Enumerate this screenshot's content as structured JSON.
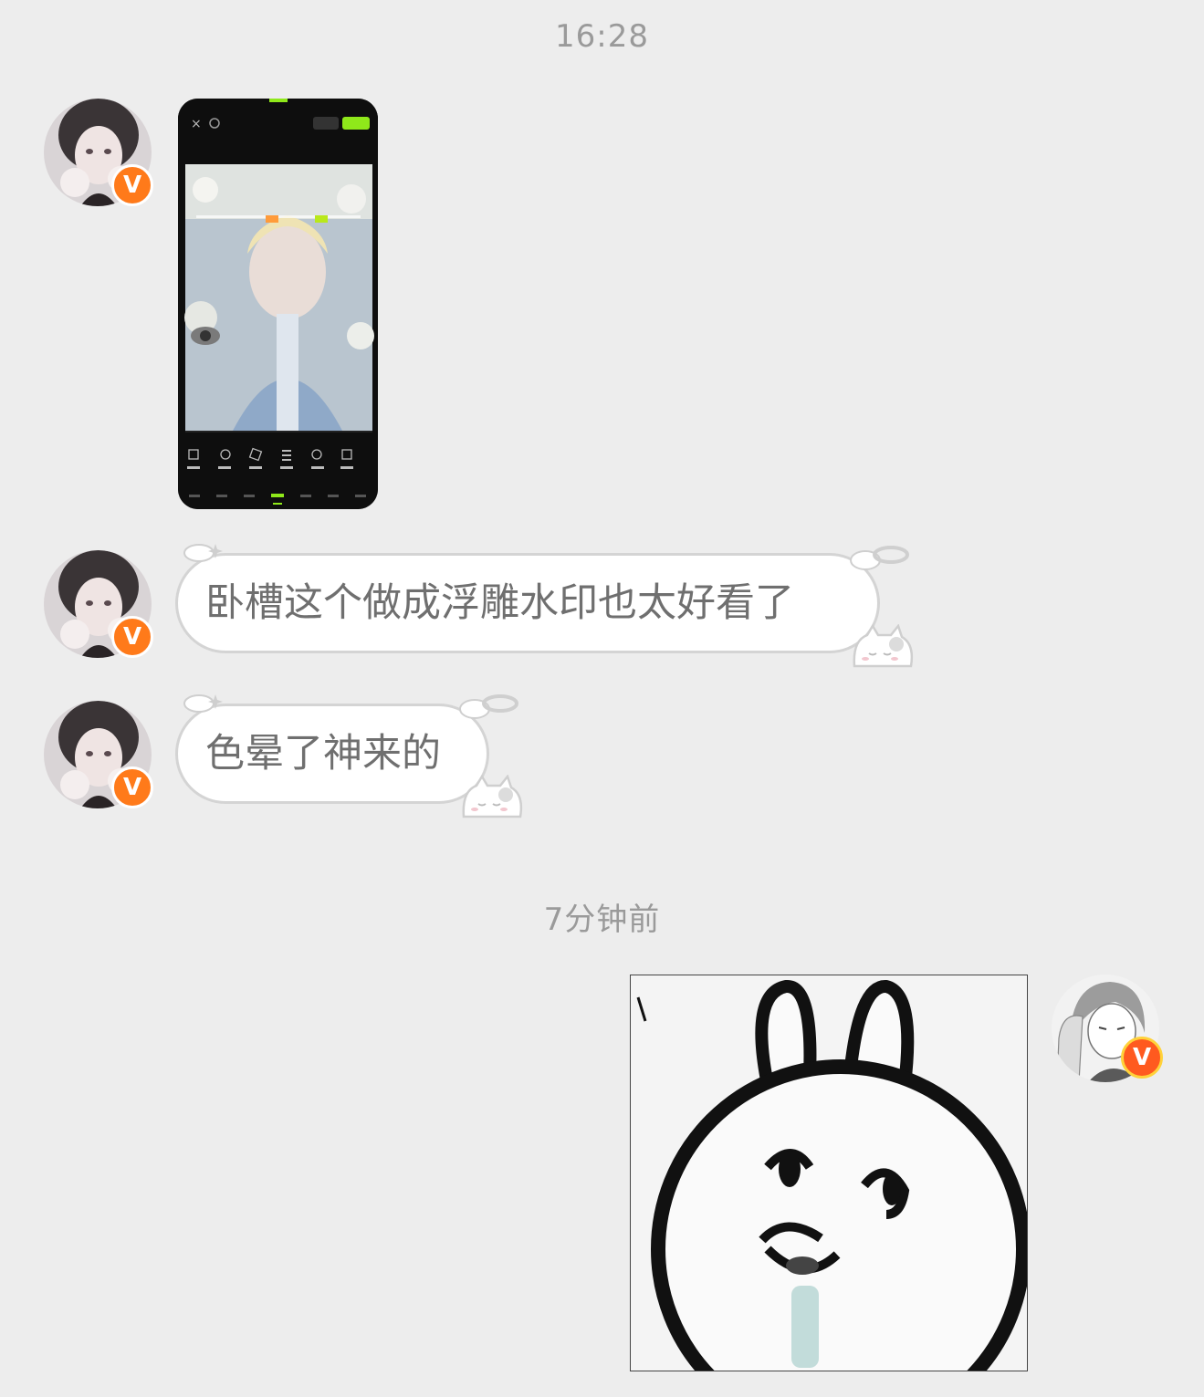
{
  "timestamps": {
    "first": "16:28",
    "second": "7分钟前"
  },
  "messages": [
    {
      "type": "image",
      "sender": "other",
      "icon": "phone-screenshot-image"
    },
    {
      "type": "text",
      "sender": "other",
      "text": "卧槽这个做成浮雕水印也太好看了"
    },
    {
      "type": "text",
      "sender": "other",
      "text": "色晕了神来的"
    },
    {
      "type": "sticker",
      "sender": "self",
      "icon": "bunny-sticker-image"
    }
  ],
  "badge": {
    "label": "V",
    "color": "#ff7a1a"
  },
  "colors": {
    "background": "#ededed",
    "bubble": "#ffffff",
    "bubble_border": "#d4d4d4",
    "accent_green": "#8fe81a"
  }
}
